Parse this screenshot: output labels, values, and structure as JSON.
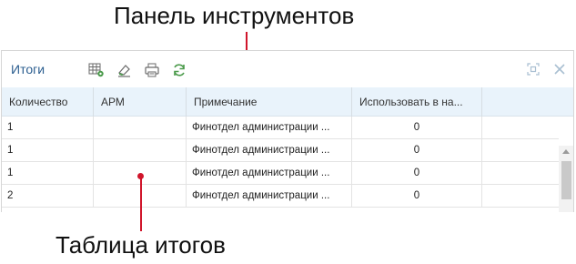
{
  "annotations": {
    "toolbar_caption": "Панель инструментов",
    "table_caption": "Таблица итогов"
  },
  "panel": {
    "title": "Итоги",
    "toolbar_icons": [
      "table-settings-icon",
      "eraser-icon",
      "print-icon",
      "refresh-icon"
    ],
    "window_icons": [
      "maximize-icon",
      "close-icon"
    ]
  },
  "table": {
    "columns": [
      "Количество",
      "АРМ",
      "Примечание",
      "Использовать в на...",
      ""
    ],
    "rows": [
      {
        "qty": "1",
        "arm": "",
        "note": "Финотдел администрации ...",
        "use": "0"
      },
      {
        "qty": "1",
        "arm": "",
        "note": "Финотдел администрации ...",
        "use": "0"
      },
      {
        "qty": "1",
        "arm": "",
        "note": "Финотдел администрации ...",
        "use": "0"
      },
      {
        "qty": "2",
        "arm": "",
        "note": "Финотдел администрации ...",
        "use": "0"
      }
    ]
  },
  "colors": {
    "accent": "#2a5d8f",
    "callout_red": "#d0152b",
    "header_bg": "#e9f3fb",
    "toolbar_icon_green": "#4a9a4a"
  }
}
